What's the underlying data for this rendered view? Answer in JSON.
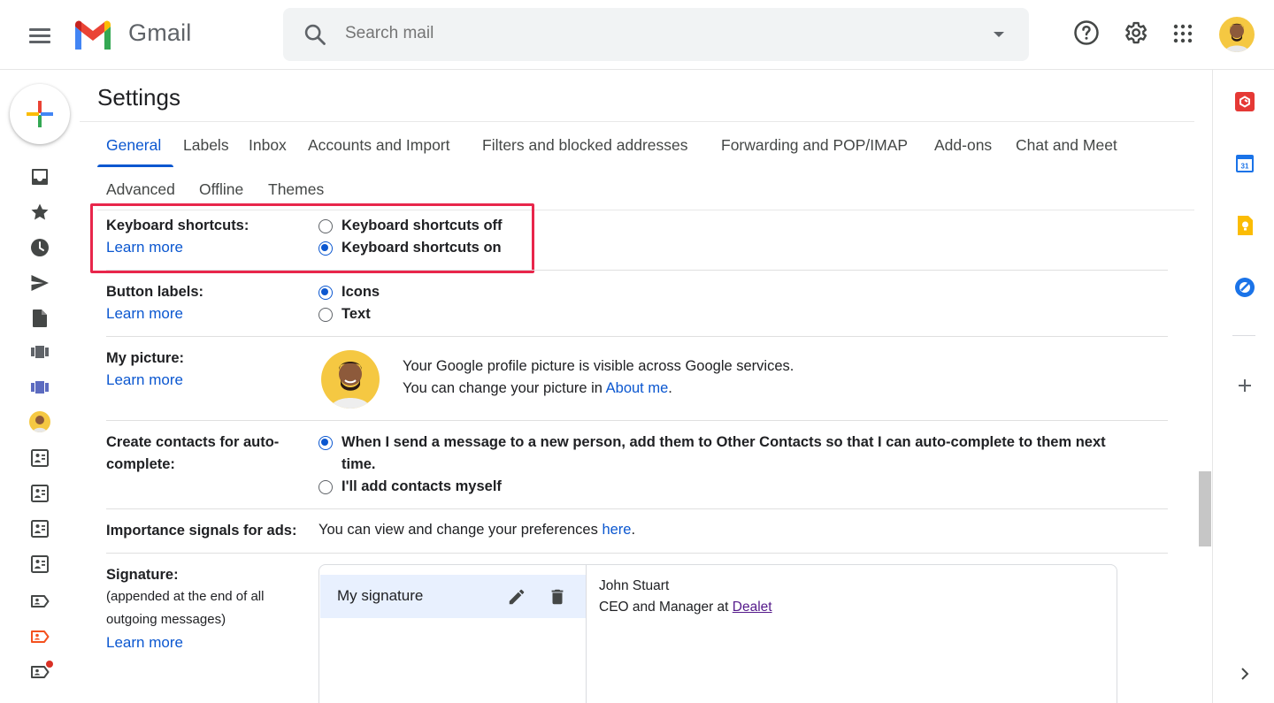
{
  "app": {
    "name": "Gmail"
  },
  "search": {
    "placeholder": "Search mail"
  },
  "page": {
    "title": "Settings"
  },
  "tabs": [
    {
      "label": "General",
      "active": true
    },
    {
      "label": "Labels"
    },
    {
      "label": "Inbox"
    },
    {
      "label": "Accounts and Import"
    },
    {
      "label": "Filters and blocked addresses"
    },
    {
      "label": "Forwarding and POP/IMAP"
    },
    {
      "label": "Add-ons"
    },
    {
      "label": "Chat and Meet"
    },
    {
      "label": "Advanced"
    },
    {
      "label": "Offline"
    },
    {
      "label": "Themes"
    }
  ],
  "settings": {
    "keyboard": {
      "label": "Keyboard shortcuts:",
      "learn_more": "Learn more",
      "option_off": "Keyboard shortcuts off",
      "option_on": "Keyboard shortcuts on",
      "selected": "on"
    },
    "button_labels": {
      "label": "Button labels:",
      "learn_more": "Learn more",
      "option_icons": "Icons",
      "option_text": "Text",
      "selected": "icons"
    },
    "picture": {
      "label": "My picture:",
      "learn_more": "Learn more",
      "line1": "Your Google profile picture is visible across Google services.",
      "line2_prefix": "You can change your picture in ",
      "line2_link": "About me",
      "line2_suffix": "."
    },
    "contacts": {
      "label": "Create contacts for auto-complete:",
      "option_auto": "When I send a message to a new person, add them to Other Contacts so that I can auto-complete to them next time.",
      "option_manual": "I'll add contacts myself",
      "selected": "auto"
    },
    "ads": {
      "label": "Importance signals for ads:",
      "text_prefix": "You can view and change your preferences ",
      "link": "here",
      "text_suffix": "."
    },
    "signature": {
      "label": "Signature:",
      "sub_line1": "(appended at the end of all",
      "sub_line2": "outgoing messages)",
      "learn_more": "Learn more",
      "item_name": "My signature",
      "content_line1": "John Stuart",
      "content_line2_prefix": "CEO and Manager at ",
      "content_line2_link": "Dealet"
    }
  },
  "colors": {
    "accent": "#0b57d0",
    "highlight": "#e8264b"
  },
  "icons": {
    "header": [
      "menu-icon",
      "search-icon",
      "help-icon",
      "settings-gear-icon",
      "apps-grid-icon"
    ],
    "rail": [
      "inbox-icon",
      "star-icon",
      "clock-icon",
      "send-icon",
      "draft-icon",
      "category-icon",
      "category-purple-icon",
      "contact-avatar",
      "photo-label-icon",
      "photo-label-icon",
      "photo-label-icon",
      "photo-label-icon",
      "tag-icon",
      "tag-orange-icon",
      "tag-notification-icon"
    ],
    "right_rail": [
      "red-app-icon",
      "calendar-icon",
      "keep-icon",
      "tasks-icon",
      "add-icon",
      "chevron-right-icon"
    ]
  }
}
